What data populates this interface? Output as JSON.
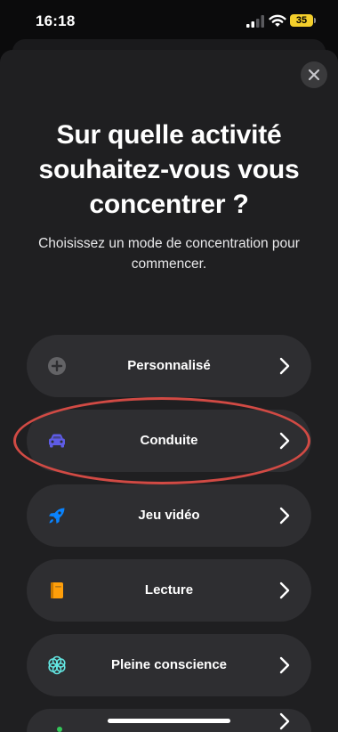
{
  "status_bar": {
    "time": "16:18",
    "battery": "35"
  },
  "sheet": {
    "title": "Sur quelle activité souhaitez-vous vous concentrer ?",
    "subtitle": "Choisissez un mode de concentration pour commencer."
  },
  "options": [
    {
      "label": "Personnalisé",
      "icon": "plus-circle-icon",
      "color": "#8e8e93"
    },
    {
      "label": "Conduite",
      "icon": "car-icon",
      "color": "#5e5ce6"
    },
    {
      "label": "Jeu vidéo",
      "icon": "rocket-icon",
      "color": "#0a84ff"
    },
    {
      "label": "Lecture",
      "icon": "book-icon",
      "color": "#ff9f0a"
    },
    {
      "label": "Pleine conscience",
      "icon": "mindfulness-flower-icon",
      "color": "#63e6e2"
    }
  ],
  "highlight_color": "#d14a44"
}
